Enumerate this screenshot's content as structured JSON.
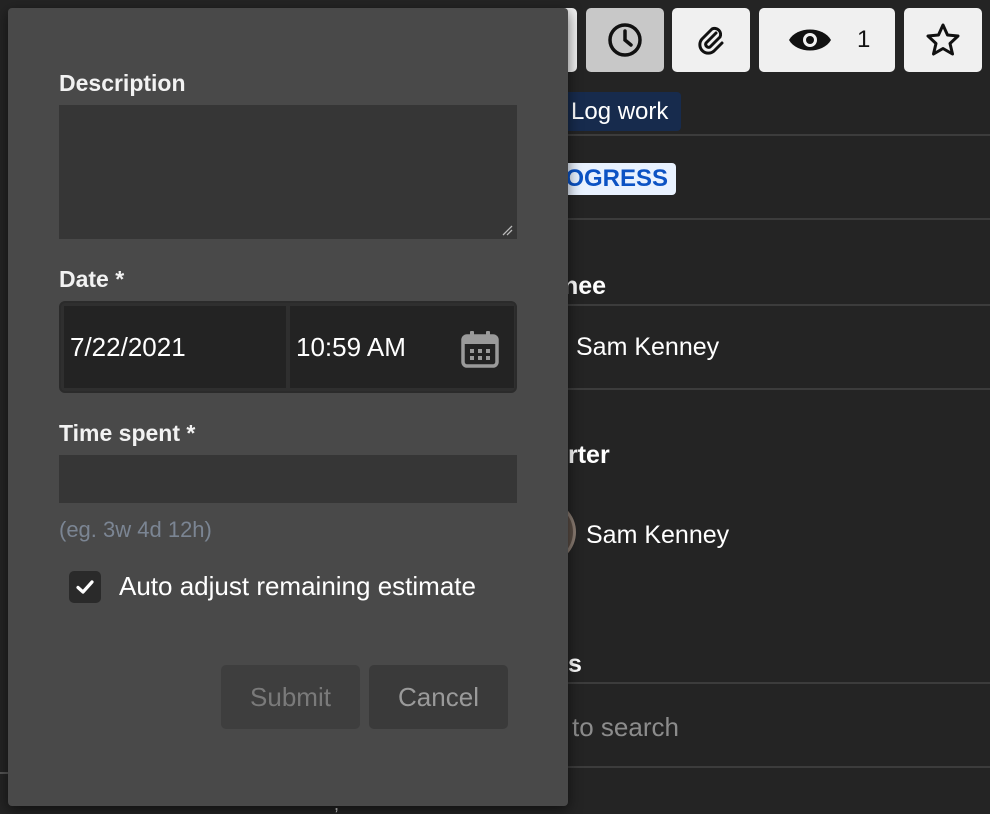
{
  "toolbar": {
    "log_work_icon": "clock-icon",
    "attach_icon": "paperclip-icon",
    "watch_icon": "eye-icon",
    "watch_count": "1",
    "star_icon": "star-icon"
  },
  "tooltip": {
    "text": "Log work"
  },
  "issue": {
    "status": "ROGRESS",
    "assignee_heading": "nee",
    "assignee_name": "Sam Kenney",
    "reporter_heading": "rter",
    "reporter_name": "Sam Kenney",
    "labels_heading": "s",
    "labels_placeholder": "to search",
    "stray": ","
  },
  "dialog": {
    "description_label": "Description",
    "description_value": "",
    "date_label": "Date *",
    "date_value": "7/22/2021",
    "time_value": "10:59 AM",
    "calendar_icon": "calendar-icon",
    "time_spent_label": "Time spent *",
    "time_spent_value": "",
    "time_spent_hint": "(eg. 3w 4d 12h)",
    "auto_adjust_checked": true,
    "auto_adjust_label": "Auto adjust remaining estimate",
    "submit_label": "Submit",
    "cancel_label": "Cancel"
  },
  "colors": {
    "background": "#242424",
    "dialog": "#494949",
    "tooltip": "#172b4d",
    "status_bg": "#e9f2ff",
    "status_text": "#0c53c4",
    "hint": "#7b8593"
  }
}
